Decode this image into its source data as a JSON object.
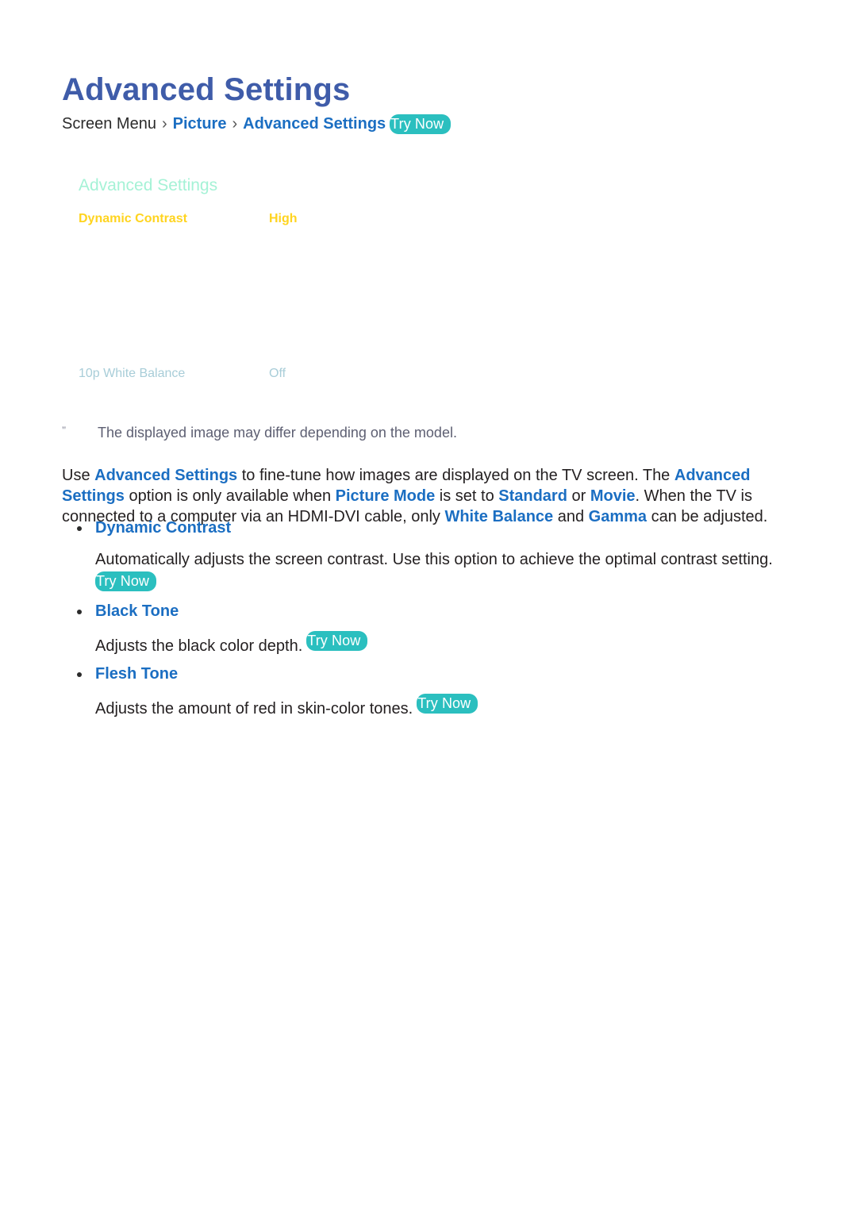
{
  "page": {
    "title": "Advanced Settings"
  },
  "breadcrumb": {
    "root": "Screen Menu",
    "separator": "›",
    "level2": "Picture",
    "level3": "Advanced Settings",
    "try_now": "Try Now"
  },
  "menu_mock": {
    "title": "Advanced Settings",
    "rows": [
      {
        "label": "Dynamic Contrast",
        "value": "High"
      },
      {
        "label": "10p White Balance",
        "value": "Off"
      }
    ]
  },
  "note": {
    "mark": "\"",
    "text": "The displayed image may differ depending on the model."
  },
  "intro": {
    "p1_a": "Use ",
    "p1_kw1": "Advanced Settings",
    "p1_b": " to fine-tune how images are displayed on the TV screen. The ",
    "p1_kw2": "Advanced Settings",
    "p1_c": " option is only available when ",
    "p1_kw3": "Picture Mode",
    "p1_d": " is set to ",
    "p1_kw4": "Standard",
    "p1_e": " or ",
    "p1_kw5": "Movie",
    "p1_f": ". When the TV is connected to a computer via an HDMI-DVI cable, only ",
    "p1_kw6": "White Balance",
    "p1_g": " and ",
    "p1_kw7": "Gamma",
    "p1_h": " can be adjusted."
  },
  "sections": [
    {
      "heading": "Dynamic Contrast",
      "body": "Automatically adjusts the screen contrast. Use this option to achieve the optimal contrast setting.",
      "try_now": "Try Now",
      "try_now_wraps": true
    },
    {
      "heading": "Black Tone",
      "body": "Adjusts the black color depth.",
      "try_now": "Try Now",
      "try_now_wraps": false
    },
    {
      "heading": "Flesh Tone",
      "body": "Adjusts the amount of red in skin-color tones.",
      "try_now": "Try Now",
      "try_now_wraps": false
    }
  ],
  "colors": {
    "title_blue": "#3f5ca9",
    "link_blue": "#1b6ec2",
    "try_now_teal": "#2bbfbf",
    "mock_title_mint": "#a5f2d6",
    "mock_highlight_yellow": "#ffd41f",
    "mock_dim_blue": "#a8cdd8",
    "note_gray": "#5d5f72",
    "body_text": "#231f20"
  }
}
